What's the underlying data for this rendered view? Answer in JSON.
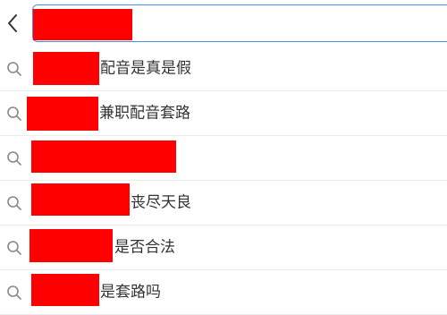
{
  "header": {
    "back_icon": "chevron-left-icon",
    "search_value": ""
  },
  "suggestions": [
    {
      "text": "配音是真是假"
    },
    {
      "text": "兼职配音套路"
    },
    {
      "text": ""
    },
    {
      "text": "丧尽天良"
    },
    {
      "text": "是否合法"
    },
    {
      "text": "是套路吗"
    }
  ],
  "colors": {
    "accent_border": "#4a90e2",
    "redaction": "#ff0000",
    "text": "#333333",
    "icon": "#888888",
    "divider": "#ececec"
  },
  "icons": {
    "suggestion_icon": "search-icon"
  }
}
